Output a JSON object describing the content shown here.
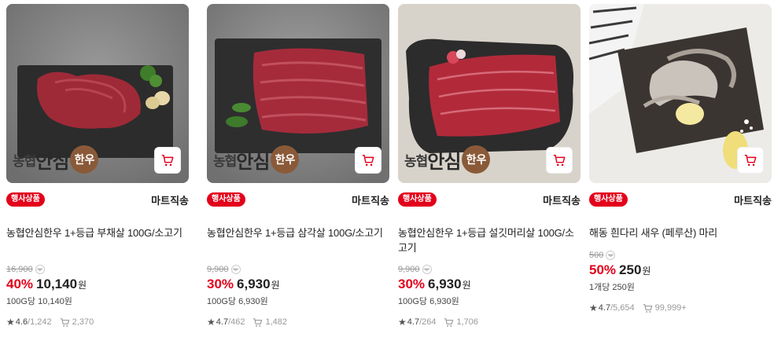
{
  "products": [
    {
      "badge": "행사상품",
      "shipping": "마트직송",
      "title": "농협안심한우 1+등급 부채살 100G/소고기",
      "original_price": "16,900",
      "discount_rate": "40%",
      "price": "10,140",
      "currency": "원",
      "unit_price": "100G당 10,140원",
      "rating": "4.6",
      "review_count": "1,242",
      "purchase_count": "2,370",
      "brand": {
        "prefix": "농협",
        "big": "안심",
        "circle": "한우"
      },
      "image_theme": "beef-slab"
    },
    {
      "badge": "행사상품",
      "shipping": "마트직송",
      "title": "농협안심한우 1+등급 삼각살 100G/소고기",
      "original_price": "9,900",
      "discount_rate": "30%",
      "price": "6,930",
      "currency": "원",
      "unit_price": "100G당 6,930원",
      "rating": "4.7",
      "review_count": "462",
      "purchase_count": "1,482",
      "brand": {
        "prefix": "농협",
        "big": "안심",
        "circle": "한우"
      },
      "image_theme": "beef-sliced"
    },
    {
      "badge": "행사상품",
      "shipping": "마트직송",
      "title": "농협안심한우 1+등급 설깃머리살 100G/소고기",
      "original_price": "9,900",
      "discount_rate": "30%",
      "price": "6,930",
      "currency": "원",
      "unit_price": "100G당 6,930원",
      "rating": "4.7",
      "review_count": "264",
      "purchase_count": "1,706",
      "brand": {
        "prefix": "농협",
        "big": "안심",
        "circle": "한우"
      },
      "image_theme": "beef-marbled"
    },
    {
      "badge": "행사상품",
      "shipping": "마트직송",
      "title": "해동 흰다리 새우 (페루산) 마리",
      "original_price": "500",
      "discount_rate": "50%",
      "price": "250",
      "currency": "원",
      "unit_price": "1개당 250원",
      "rating": "4.7",
      "review_count": "5,654",
      "purchase_count": "99,999+",
      "image_theme": "shrimp"
    }
  ],
  "icons": {
    "cart": "cart-icon",
    "star": "star-icon",
    "purchase": "purchase-icon",
    "chevron": "chevron-down-icon"
  },
  "colors": {
    "accent_red": "#e3001b",
    "text": "#222222",
    "muted": "#999999"
  }
}
